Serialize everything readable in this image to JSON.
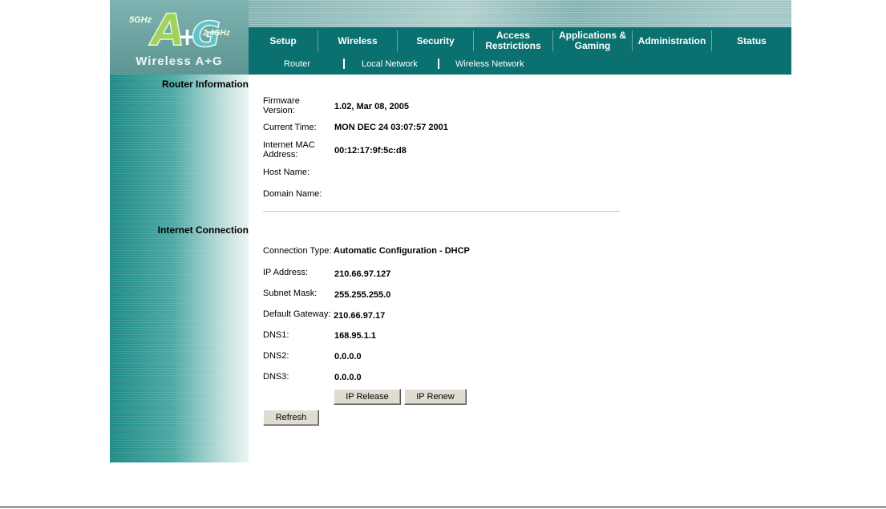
{
  "branding": {
    "logo_text_5ghz": "5GHz",
    "logo_text_24ghz": "2.4GHz",
    "logo_caption": "Wireless A+G"
  },
  "nav": {
    "tabs": [
      {
        "label": "Setup"
      },
      {
        "label": "Wireless"
      },
      {
        "label": "Security"
      },
      {
        "label": "Access Restrictions"
      },
      {
        "label": "Applications & Gaming"
      },
      {
        "label": "Administration"
      },
      {
        "label": "Status"
      }
    ],
    "active_tab": "Status",
    "subtabs": [
      {
        "label": "Router"
      },
      {
        "label": "Local Network"
      },
      {
        "label": "Wireless Network"
      }
    ]
  },
  "router_info": {
    "section_title": "Router Information",
    "firmware_label": "Firmware Version:",
    "firmware_value": "1.02, Mar 08, 2005",
    "time_label": "Current Time:",
    "time_value": "MON DEC 24 03:07:57 2001",
    "mac_label": "Internet MAC Address:",
    "mac_value": "00:12:17:9f:5c:d8",
    "host_label": "Host Name:",
    "host_value": "",
    "domain_label": "Domain Name:",
    "domain_value": ""
  },
  "internet": {
    "section_title": "Internet Connection",
    "conn_type_label": "Connection Type:",
    "conn_type_value": "Automatic Configuration - DHCP",
    "ip_label": "IP Address:",
    "ip_value": "210.66.97.127",
    "mask_label": "Subnet Mask:",
    "mask_value": "255.255.255.0",
    "gateway_label": "Default Gateway:",
    "gateway_value": "210.66.97.17",
    "dns1_label": "DNS1:",
    "dns1_value": "168.95.1.1",
    "dns2_label": "DNS2:",
    "dns2_value": "0.0.0.0",
    "dns3_label": "DNS3:",
    "dns3_value": "0.0.0.0"
  },
  "buttons": {
    "ip_release": "IP Release",
    "ip_renew": "IP Renew",
    "refresh": "Refresh"
  },
  "colors": {
    "nav_bg": "#0b7170",
    "banner_bg": "#6fa6a4"
  }
}
